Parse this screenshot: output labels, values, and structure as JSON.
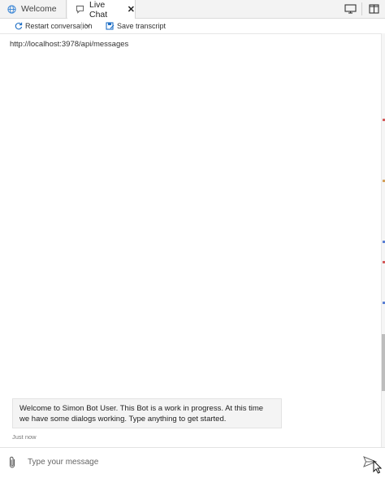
{
  "tabs": [
    {
      "label": "Welcome",
      "icon": "globe-icon"
    },
    {
      "label": "Live Chat",
      "icon": "chat-icon",
      "close": "✕"
    }
  ],
  "toolbar": {
    "restart_label": "Restart conversation",
    "save_label": "Save transcript"
  },
  "endpoint": "http://localhost:3978/api/messages",
  "messages": [
    {
      "text": "Welcome to Simon Bot User. This Bot is a work in progress. At this time we have some dialogs working. Type anything to get started.",
      "timestamp": "Just now"
    }
  ],
  "composer": {
    "placeholder": "Type your message"
  },
  "colors": {
    "accent": "#1f6fc5",
    "tab_bar": "#f3f3f3",
    "bubble": "#f4f4f4"
  }
}
